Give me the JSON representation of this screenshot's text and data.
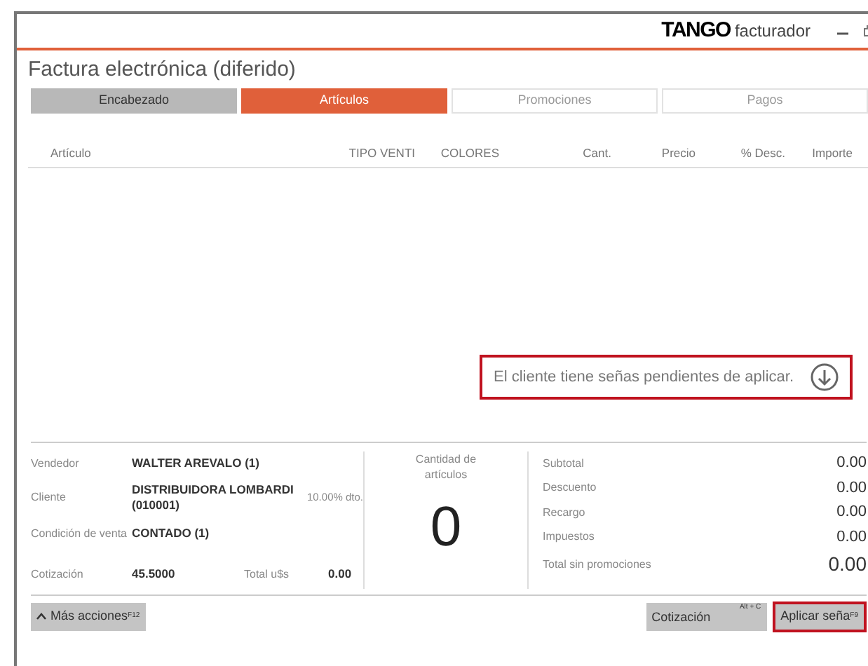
{
  "window": {
    "logo": "TANGO",
    "app_name": "facturador"
  },
  "title": "Factura electrónica (diferido)",
  "tabs": [
    {
      "label": "Encabezado",
      "selected": false,
      "disabled": false
    },
    {
      "label": "Artículos",
      "selected": true,
      "disabled": false
    },
    {
      "label": "Promociones",
      "selected": false,
      "disabled": true
    },
    {
      "label": "Pagos",
      "selected": false,
      "disabled": true
    }
  ],
  "table": {
    "columns": [
      "Artículo",
      "TIPO VENTI",
      "COLORES",
      "Cant.",
      "Precio",
      "% Desc.",
      "Importe"
    ]
  },
  "notice": {
    "text": "El cliente tiene señas pendientes de aplicar."
  },
  "info": {
    "vendedor_label": "Vendedor",
    "vendedor": "WALTER AREVALO (1)",
    "cliente_label": "Cliente",
    "cliente": "DISTRIBUIDORA LOMBARDI (010001)",
    "descuento_cliente": "10.00% dto.",
    "condicion_label": "Condición de venta",
    "condicion": "CONTADO (1)",
    "cotizacion_label": "Cotización",
    "cotizacion": "45.5000",
    "total_usd_label": "Total u$s",
    "total_usd": "0.00"
  },
  "quantity": {
    "label": "Cantidad de artículos",
    "value": "0"
  },
  "totals": [
    {
      "label": "Subtotal",
      "value": "0.00"
    },
    {
      "label": "Descuento",
      "value": "0.00"
    },
    {
      "label": "Recargo",
      "value": "0.00"
    },
    {
      "label": "Impuestos",
      "value": "0.00"
    }
  ],
  "grand_total": {
    "label": "Total sin promociones",
    "value": "0.00"
  },
  "footer": {
    "more": {
      "label": "Más acciones",
      "shortcut": "F12"
    },
    "cotizacion": {
      "label": "Cotización",
      "shortcut": "Alt + C"
    },
    "apply": {
      "label": "Aplicar seña",
      "shortcut": "F9"
    }
  }
}
